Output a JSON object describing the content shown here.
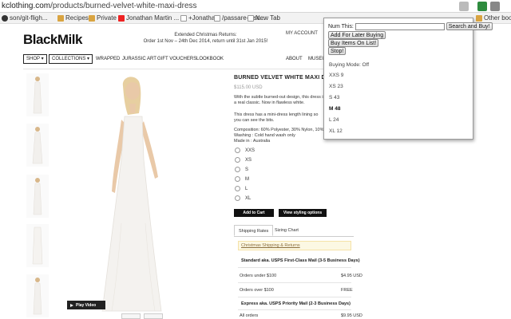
{
  "browser": {
    "url_prefix": "kclothing.com",
    "url_path": "/products/burned-velvet-white-maxi-dress",
    "bookmarks": [
      {
        "label": "son/git-fligh...",
        "icon": "github-icon"
      },
      {
        "label": "Recipes",
        "icon": "folder-icon"
      },
      {
        "label": "Private",
        "icon": "folder-icon"
      },
      {
        "label": "Jonathan Martin ...",
        "icon": "youtube-icon"
      },
      {
        "label": "+Jonathan",
        "icon": "google-plus-icon"
      },
      {
        "label": "/passare-disc...",
        "icon": "page-icon"
      },
      {
        "label": "New Tab",
        "icon": "page-icon"
      }
    ],
    "other_bookmarks": "Other bookm"
  },
  "site": {
    "logo": "BlackMilk",
    "promo_line1": "Extended Christmas Returns:",
    "promo_line2": "Order 1st Nov – 24th Dec 2014, return until 31st Jan 2015!",
    "my_account": "MY ACCOUNT",
    "nav": {
      "shop": "SHOP ▾",
      "collections": "COLLECTIONS ▾",
      "wrapped": "WRAPPED",
      "jurassic": "JURASSIC ART",
      "gift": "GIFT VOUCHERS",
      "lookbook": "LOOKBOOK",
      "about": "ABOUT",
      "museum": "MUSEU"
    }
  },
  "gallery": {
    "play_video": "Play Video"
  },
  "product": {
    "title": "BURNED VELVET WHITE MAXI DRESS",
    "price": "$115.00 USD",
    "desc1": "With the subtle burned-out design, this dress is a real classic. Now in flawless white.",
    "desc2": "This dress has a mini-dress length lining so you can see the bits.",
    "composition": "Composition: 60% Polyester, 30% Nylon, 10%",
    "washing": "Washing : Cold hand wash only",
    "made_in": "Made in : Australia",
    "sizes": [
      "XXS",
      "XS",
      "S",
      "M",
      "L",
      "XL"
    ],
    "add_to_cart": "Add to Cart",
    "view_styling": "View styling options"
  },
  "shipping": {
    "tab_rates": "Shipping Rates",
    "tab_size": "Sizing Chart",
    "note": "Christmas Shipping & Returns",
    "standard_head": "Standard aka. USPS First-Class Mail (3-5 Business Days)",
    "row1_label": "Orders under $100",
    "row1_value": "$4.95 USD",
    "row2_label": "Orders over $100",
    "row2_value": "FREE",
    "express_head": "Express aka. USPS Priority Mail (2-3 Business Days)",
    "row3_label": "All orders",
    "row3_value": "$9.95 USD"
  },
  "popup": {
    "num_label": "Num This:",
    "search_buy": "Search and Buy!",
    "add_later": "Add For Later Buying",
    "buy_list": "Buy Items On List!",
    "stop": "Stop!",
    "mode": "Buying Mode: Off",
    "options": [
      "XXS 9",
      "XS 23",
      "S 43",
      "M 48",
      "L 24",
      "XL 12"
    ],
    "selected": "M 48"
  }
}
